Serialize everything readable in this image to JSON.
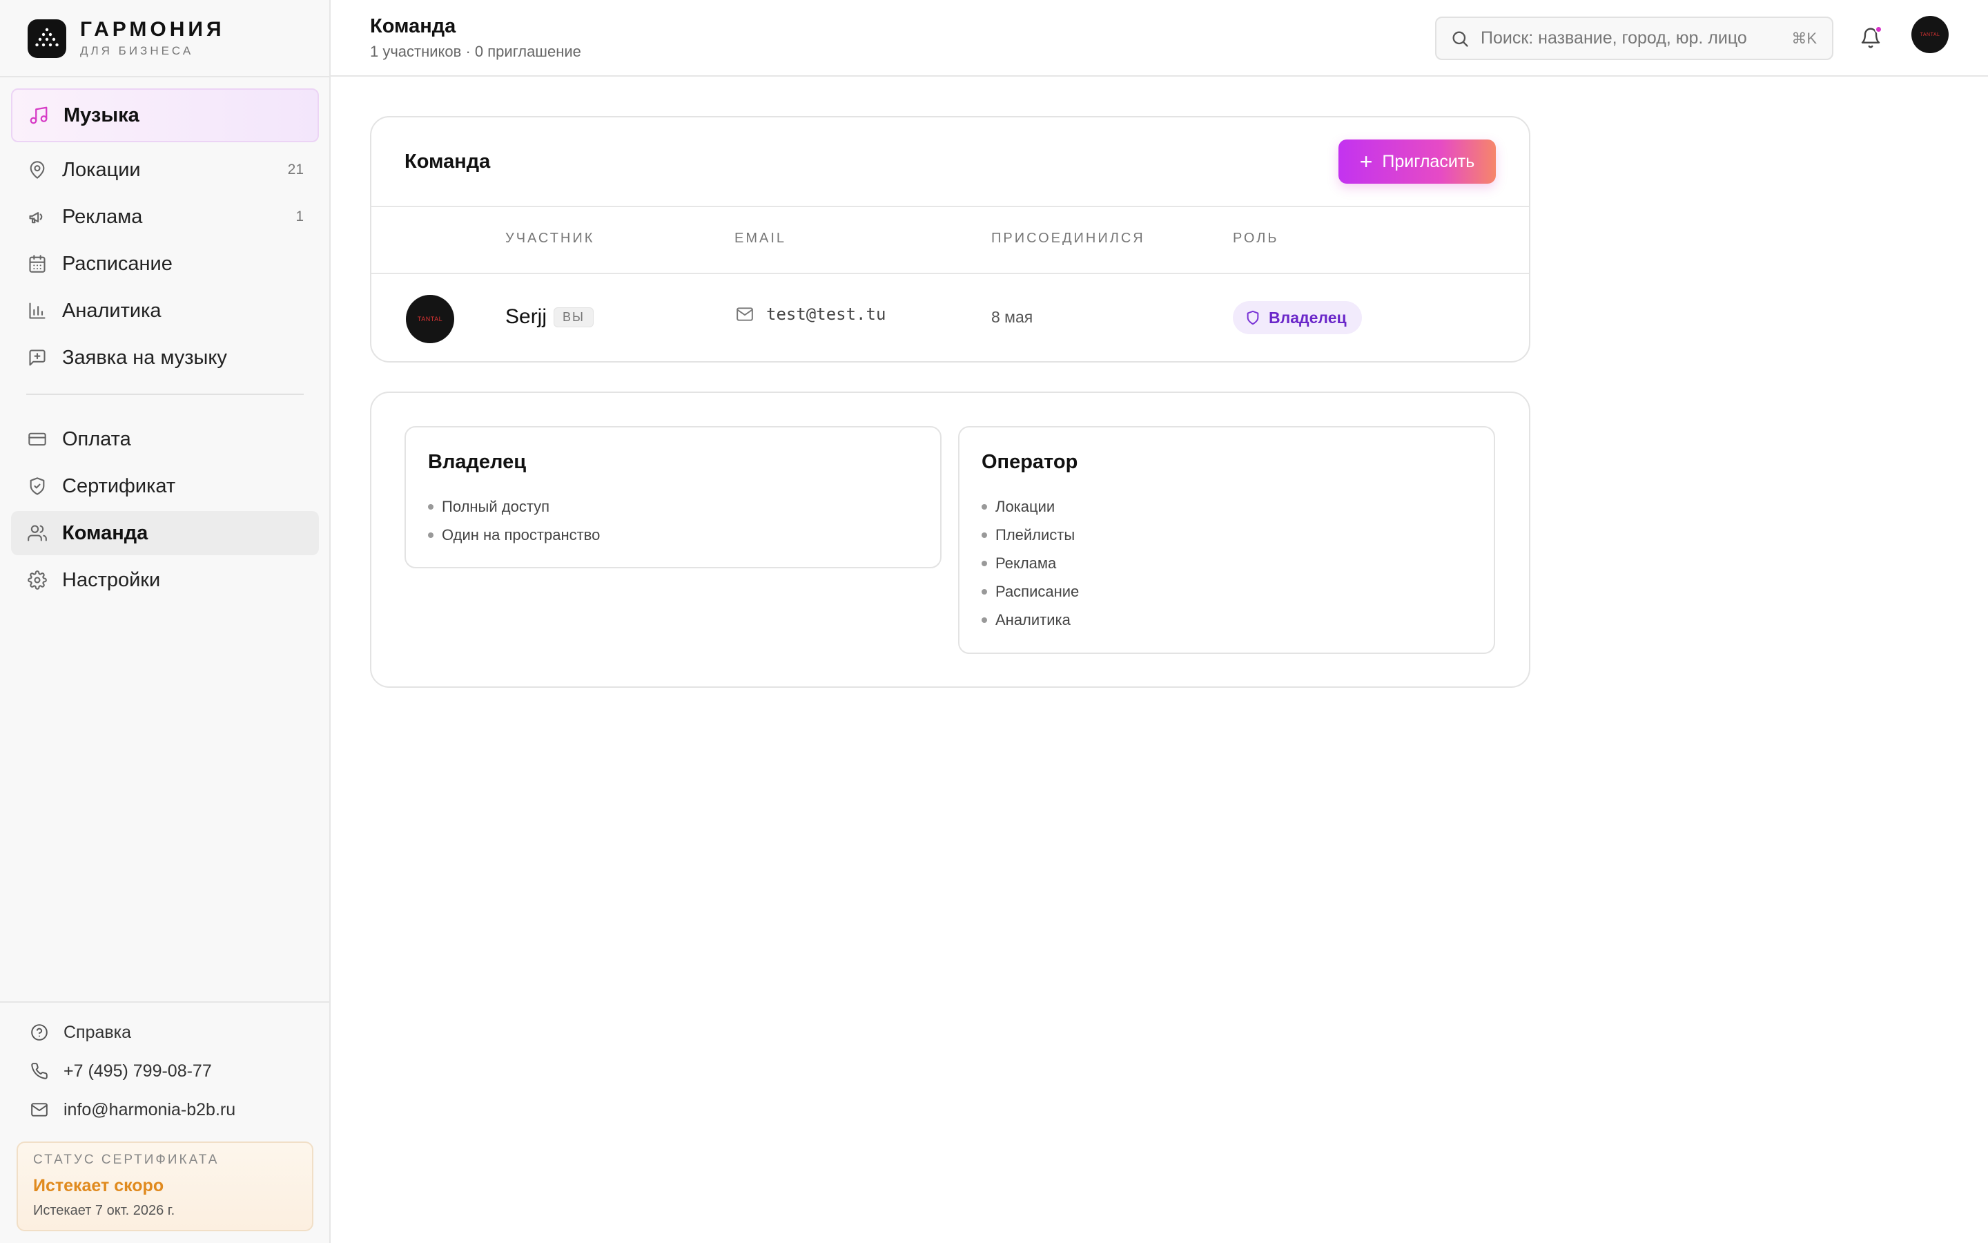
{
  "brand": {
    "title": "ГАРМОНИЯ",
    "subtitle": "ДЛЯ БИЗНЕСА"
  },
  "sidebar": {
    "music": {
      "label": "Музыка",
      "icon": "music-note-icon"
    },
    "main_items": [
      {
        "label": "Локации",
        "count": "21",
        "icon": "map-pin-icon"
      },
      {
        "label": "Реклама",
        "count": "1",
        "icon": "megaphone-icon"
      },
      {
        "label": "Расписание",
        "count": "",
        "icon": "calendar-icon"
      },
      {
        "label": "Аналитика",
        "count": "",
        "icon": "bar-chart-icon"
      },
      {
        "label": "Заявка на музыку",
        "count": "",
        "icon": "message-plus-icon"
      }
    ],
    "secondary_items": [
      {
        "label": "Оплата",
        "icon": "credit-card-icon"
      },
      {
        "label": "Сертификат",
        "icon": "shield-check-icon"
      },
      {
        "label": "Команда",
        "icon": "users-icon",
        "active": true
      },
      {
        "label": "Настройки",
        "icon": "gear-icon"
      }
    ],
    "footer": {
      "help": "Справка",
      "phone": "+7 (495) 799-08-77",
      "email": "info@harmonia-b2b.ru"
    },
    "certificate": {
      "heading": "СТАТУС СЕРТИФИКАТА",
      "status": "Истекает скоро",
      "expires": "Истекает 7 окт. 2026 г."
    }
  },
  "header": {
    "title": "Команда",
    "subtitle": "1 участников · 0 приглашение",
    "search_placeholder": "Поиск: название, город, юр. лицо",
    "search_shortcut": "⌘K",
    "avatar_text": "TANTAL"
  },
  "team": {
    "title": "Команда",
    "invite_label": "Пригласить",
    "columns": [
      "УЧАСТНИК",
      "EMAIL",
      "ПРИСОЕДИНИЛСЯ",
      "РОЛЬ"
    ],
    "members": [
      {
        "name": "Serjj",
        "badge": "ВЫ",
        "email": "test@test.tu",
        "joined": "8 мая",
        "role": "Владелец",
        "avatar_text": "TANTAL"
      }
    ]
  },
  "roles": [
    {
      "title": "Владелец",
      "permissions": [
        "Полный доступ",
        "Один на пространство"
      ]
    },
    {
      "title": "Оператор",
      "permissions": [
        "Локации",
        "Плейлисты",
        "Реклама",
        "Расписание",
        "Аналитика"
      ]
    }
  ],
  "colors": {
    "accent": "#d63cc6",
    "invite_gradient_start": "#c333f0",
    "invite_gradient_end": "#f6866a",
    "role_text": "#6a26c9",
    "cert_status": "#e08a1e"
  }
}
